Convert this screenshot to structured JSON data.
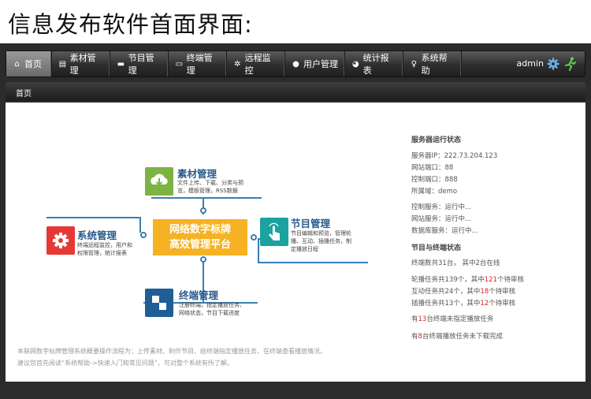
{
  "heading": "信息发布软件首面界面:",
  "nav": {
    "items": [
      {
        "label": "首页",
        "icon": "home-icon"
      },
      {
        "label": "素材管理",
        "icon": "document-icon"
      },
      {
        "label": "节目管理",
        "icon": "folder-icon"
      },
      {
        "label": "终端管理",
        "icon": "monitor-icon"
      },
      {
        "label": "远程监控",
        "icon": "gear-icon"
      },
      {
        "label": "用户管理",
        "icon": "user-icon"
      },
      {
        "label": "统计报表",
        "icon": "pie-chart-icon"
      },
      {
        "label": "系统帮助",
        "icon": "bulb-icon"
      }
    ],
    "user": "admin"
  },
  "breadcrumb": "首页",
  "diagram": {
    "center": {
      "line1": "网络数字标牌",
      "line2": "高效管理平台"
    },
    "material": {
      "title": "素材管理",
      "desc1": "文件上传、下载、分类与预",
      "desc2": "览，模板管理，RSS数据"
    },
    "program": {
      "title": "节目管理",
      "desc1": "节目编辑和预览，管理轮",
      "desc2": "播、互动、插播任务，制",
      "desc3": "定播放日程"
    },
    "system": {
      "title": "系统管理",
      "desc1": "终端远程监控，用户和",
      "desc2": "权限管理，统计报表"
    },
    "terminal": {
      "title": "终端管理",
      "desc1": "注册终端，指定播放任务、",
      "desc2": "网络状态，节目下载进度"
    }
  },
  "server_status": {
    "title": "服务器运行状态",
    "ip": "服务器IP：222.73.204.123",
    "web_port": "网站端口：88",
    "ctrl_port": "控制端口：888",
    "domain": "所属域：demo",
    "ctrl_service": "控制服务：运行中...",
    "web_service": "网站服务：运行中...",
    "db_service": "数据库服务：运行中..."
  },
  "program_status": {
    "title": "节目与终端状态",
    "terminals": "终端数共31台，  其中2台在线",
    "loop_pre": "轮播任务共139个，其中",
    "loop_num": "121",
    "loop_post": "个待审核",
    "inter_pre": "互动任务共24个，其中",
    "inter_num": "18",
    "inter_post": "个待审核",
    "insert_pre": "插播任务共13个，其中",
    "insert_num": "12",
    "insert_post": "个待审核",
    "unassigned_pre": "有",
    "unassigned_num": "13",
    "unassigned_post": "台终端未指定播放任务",
    "undownloaded_pre": "有",
    "undownloaded_num": "8",
    "undownloaded_post": "台终端播放任务未下载完成"
  },
  "intro": {
    "line1": "本联网数字标牌管理系统概要操作流程为：上传素材、制作节目、给终端指定播放任务、在终端查看播放情况。",
    "line2": "建议您首先阅读“系统帮助->快速入门和常见问题”，可对整个系统有所了解。"
  },
  "colors": {
    "accent_blue": "#3a7fb0",
    "orange": "#f6b223",
    "green": "#7cb342",
    "teal": "#1aa3a0",
    "red": "#e53935",
    "navy": "#1f5e96"
  }
}
